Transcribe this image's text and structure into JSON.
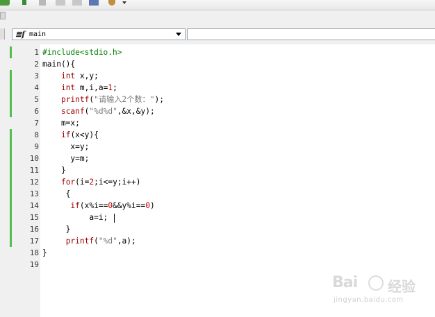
{
  "toolbar": {
    "icons": [
      "build-icon",
      "run-icon",
      "stop-icon",
      "indent-icon",
      "outdent-icon",
      "window-icon",
      "settings-icon",
      "dropdown-icon"
    ]
  },
  "function_bar": {
    "icon_glyph": "≣f",
    "selected_function": "main"
  },
  "editor": {
    "line_numbers": [
      "1",
      "2",
      "3",
      "4",
      "5",
      "6",
      "7",
      "8",
      "9",
      "10",
      "11",
      "12",
      "13",
      "14",
      "15",
      "16",
      "17",
      "18",
      "19"
    ],
    "changed_line_ranges": [
      [
        1,
        1
      ],
      [
        3,
        6
      ],
      [
        8,
        11
      ],
      [
        12,
        17
      ]
    ],
    "lines": [
      [
        {
          "t": "#include<stdio.h>",
          "c": "pp"
        }
      ],
      [
        {
          "t": "main(){",
          "c": "tx"
        }
      ],
      [
        {
          "t": "    ",
          "c": "tx"
        },
        {
          "t": "int",
          "c": "kw"
        },
        {
          "t": " x,y;",
          "c": "tx"
        }
      ],
      [
        {
          "t": "    ",
          "c": "tx"
        },
        {
          "t": "int",
          "c": "kw"
        },
        {
          "t": " m,i,a=",
          "c": "tx"
        },
        {
          "t": "1",
          "c": "nm"
        },
        {
          "t": ";",
          "c": "tx"
        }
      ],
      [
        {
          "t": "    ",
          "c": "tx"
        },
        {
          "t": "printf",
          "c": "kw"
        },
        {
          "t": "(",
          "c": "tx"
        },
        {
          "t": "\"请输入2个数：\"",
          "c": "st"
        },
        {
          "t": ");",
          "c": "tx"
        }
      ],
      [
        {
          "t": "    ",
          "c": "tx"
        },
        {
          "t": "scanf",
          "c": "kw"
        },
        {
          "t": "(",
          "c": "tx"
        },
        {
          "t": "\"%d%d\"",
          "c": "st"
        },
        {
          "t": ",&x,&y);",
          "c": "tx"
        }
      ],
      [
        {
          "t": "    m=x;",
          "c": "tx"
        }
      ],
      [
        {
          "t": "    ",
          "c": "tx"
        },
        {
          "t": "if",
          "c": "kw"
        },
        {
          "t": "(x<y){",
          "c": "tx"
        }
      ],
      [
        {
          "t": "      x=y;",
          "c": "tx"
        }
      ],
      [
        {
          "t": "      y=m;",
          "c": "tx"
        }
      ],
      [
        {
          "t": "    }",
          "c": "tx"
        }
      ],
      [
        {
          "t": "    ",
          "c": "tx"
        },
        {
          "t": "for",
          "c": "kw"
        },
        {
          "t": "(i=",
          "c": "tx"
        },
        {
          "t": "2",
          "c": "nm"
        },
        {
          "t": ";i<=y;i++)",
          "c": "tx"
        }
      ],
      [
        {
          "t": "     {",
          "c": "tx"
        }
      ],
      [
        {
          "t": "      ",
          "c": "tx"
        },
        {
          "t": "if",
          "c": "kw"
        },
        {
          "t": "(x%i==",
          "c": "tx"
        },
        {
          "t": "0",
          "c": "nm"
        },
        {
          "t": "&&y%i==",
          "c": "tx"
        },
        {
          "t": "0",
          "c": "nm"
        },
        {
          "t": ")",
          "c": "tx"
        }
      ],
      [
        {
          "t": "          a=i; ",
          "c": "tx"
        },
        {
          "t": "|caret|",
          "c": "caret"
        }
      ],
      [
        {
          "t": "     }",
          "c": "tx"
        }
      ],
      [
        {
          "t": "     ",
          "c": "tx"
        },
        {
          "t": "printf",
          "c": "kw"
        },
        {
          "t": "(",
          "c": "tx"
        },
        {
          "t": "\"%d\"",
          "c": "st"
        },
        {
          "t": ",a);",
          "c": "tx"
        }
      ],
      [
        {
          "t": "}",
          "c": "tx"
        }
      ],
      []
    ]
  },
  "watermark": {
    "logo": "Bai",
    "logo_cn": "经验",
    "url": "jingyan.baidu.com"
  },
  "colors": {
    "change_bar": "#4fbf4f",
    "keyword": "#a00000",
    "preprocessor": "#008000",
    "string": "#7a7a7a",
    "number": "#c00000"
  }
}
